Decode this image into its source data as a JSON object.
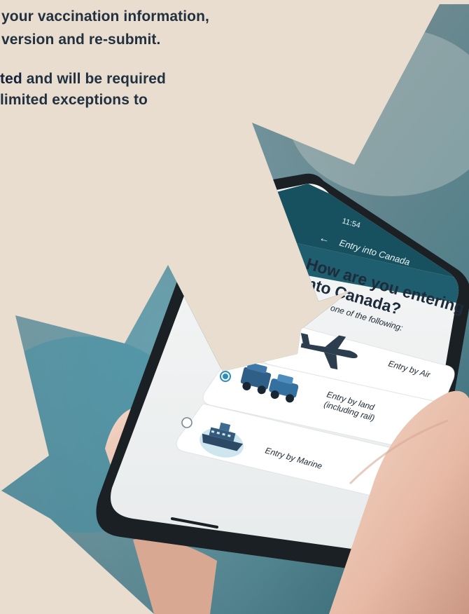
{
  "background_color": "#e9ddd0",
  "text": {
    "line1": "your vaccination information,",
    "line2": "version and re-submit.",
    "line3_accent": "ted",
    "line3_rest": " and will be required",
    "line4": "limited exceptions to"
  },
  "phone": {
    "status_time": "11:54",
    "header_title": "Entry into Canada",
    "question_line1": "How are you entering",
    "question_line2": "into Canada?",
    "instruction": "lect from one of the following:",
    "options": [
      {
        "label": "Entry by Air",
        "icon": "airplane-icon",
        "selected": false
      },
      {
        "label_line1": "Entry by land",
        "label_line2": "(including rail)",
        "icon": "car-icon",
        "selected": true
      },
      {
        "label": "Entry by Marine",
        "icon": "ship-icon",
        "selected": false
      }
    ],
    "header_color": "#1f5e6e"
  }
}
